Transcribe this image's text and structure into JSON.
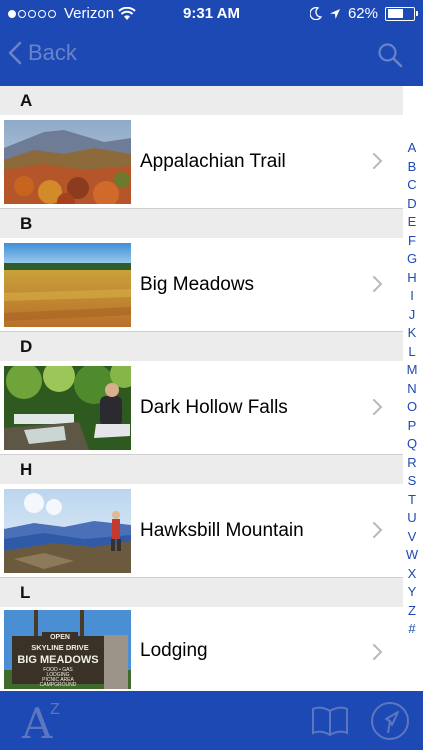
{
  "status": {
    "carrier": "Verizon",
    "time": "9:31 AM",
    "battery": "62%",
    "signal_bars": 1,
    "battery_level": 0.62
  },
  "nav": {
    "back_label": "Back"
  },
  "sections": [
    {
      "letter": "A",
      "item": "Appalachian Trail"
    },
    {
      "letter": "B",
      "item": "Big Meadows"
    },
    {
      "letter": "D",
      "item": "Dark Hollow Falls"
    },
    {
      "letter": "H",
      "item": "Hawksbill Mountain"
    },
    {
      "letter": "L",
      "item": "Lodging"
    }
  ],
  "sign": {
    "line1": "OPEN",
    "line2": "SKYLINE DRIVE",
    "line3": "BIG MEADOWS",
    "line4": "FOOD • GAS",
    "line5": "LODGING",
    "line6": "PICNIC AREA",
    "line7": "CAMPGROUND"
  },
  "index": [
    "A",
    "B",
    "C",
    "D",
    "E",
    "F",
    "G",
    "H",
    "I",
    "J",
    "K",
    "L",
    "M",
    "N",
    "O",
    "P",
    "Q",
    "R",
    "S",
    "T",
    "U",
    "V",
    "W",
    "X",
    "Y",
    "Z",
    "#"
  ],
  "bottom": {
    "az_big": "A",
    "az_small": "Z"
  },
  "colors": {
    "bar": "#1d49b5",
    "section_header": "#ececec",
    "index_letters": "#1d49b5"
  }
}
